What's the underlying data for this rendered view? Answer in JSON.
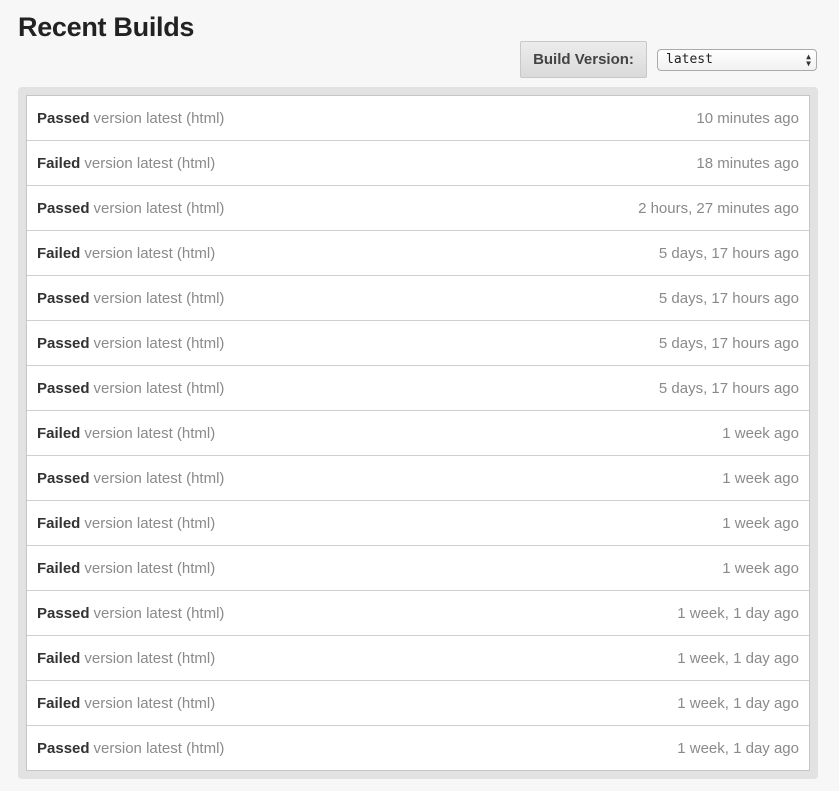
{
  "page": {
    "title": "Recent Builds"
  },
  "version_filter": {
    "label": "Build Version:",
    "selected": "latest"
  },
  "builds": [
    {
      "status": "Passed",
      "description": "version latest (html)",
      "time": "10 minutes ago"
    },
    {
      "status": "Failed",
      "description": "version latest (html)",
      "time": "18 minutes ago"
    },
    {
      "status": "Passed",
      "description": "version latest (html)",
      "time": "2 hours, 27 minutes ago"
    },
    {
      "status": "Failed",
      "description": "version latest (html)",
      "time": "5 days, 17 hours ago"
    },
    {
      "status": "Passed",
      "description": "version latest (html)",
      "time": "5 days, 17 hours ago"
    },
    {
      "status": "Passed",
      "description": "version latest (html)",
      "time": "5 days, 17 hours ago"
    },
    {
      "status": "Passed",
      "description": "version latest (html)",
      "time": "5 days, 17 hours ago"
    },
    {
      "status": "Failed",
      "description": "version latest (html)",
      "time": "1 week ago"
    },
    {
      "status": "Passed",
      "description": "version latest (html)",
      "time": "1 week ago"
    },
    {
      "status": "Failed",
      "description": "version latest (html)",
      "time": "1 week ago"
    },
    {
      "status": "Failed",
      "description": "version latest (html)",
      "time": "1 week ago"
    },
    {
      "status": "Passed",
      "description": "version latest (html)",
      "time": "1 week, 1 day ago"
    },
    {
      "status": "Failed",
      "description": "version latest (html)",
      "time": "1 week, 1 day ago"
    },
    {
      "status": "Failed",
      "description": "version latest (html)",
      "time": "1 week, 1 day ago"
    },
    {
      "status": "Passed",
      "description": "version latest (html)",
      "time": "1 week, 1 day ago"
    }
  ],
  "icons": {
    "select_arrows": "up-down-chevron-icon"
  }
}
